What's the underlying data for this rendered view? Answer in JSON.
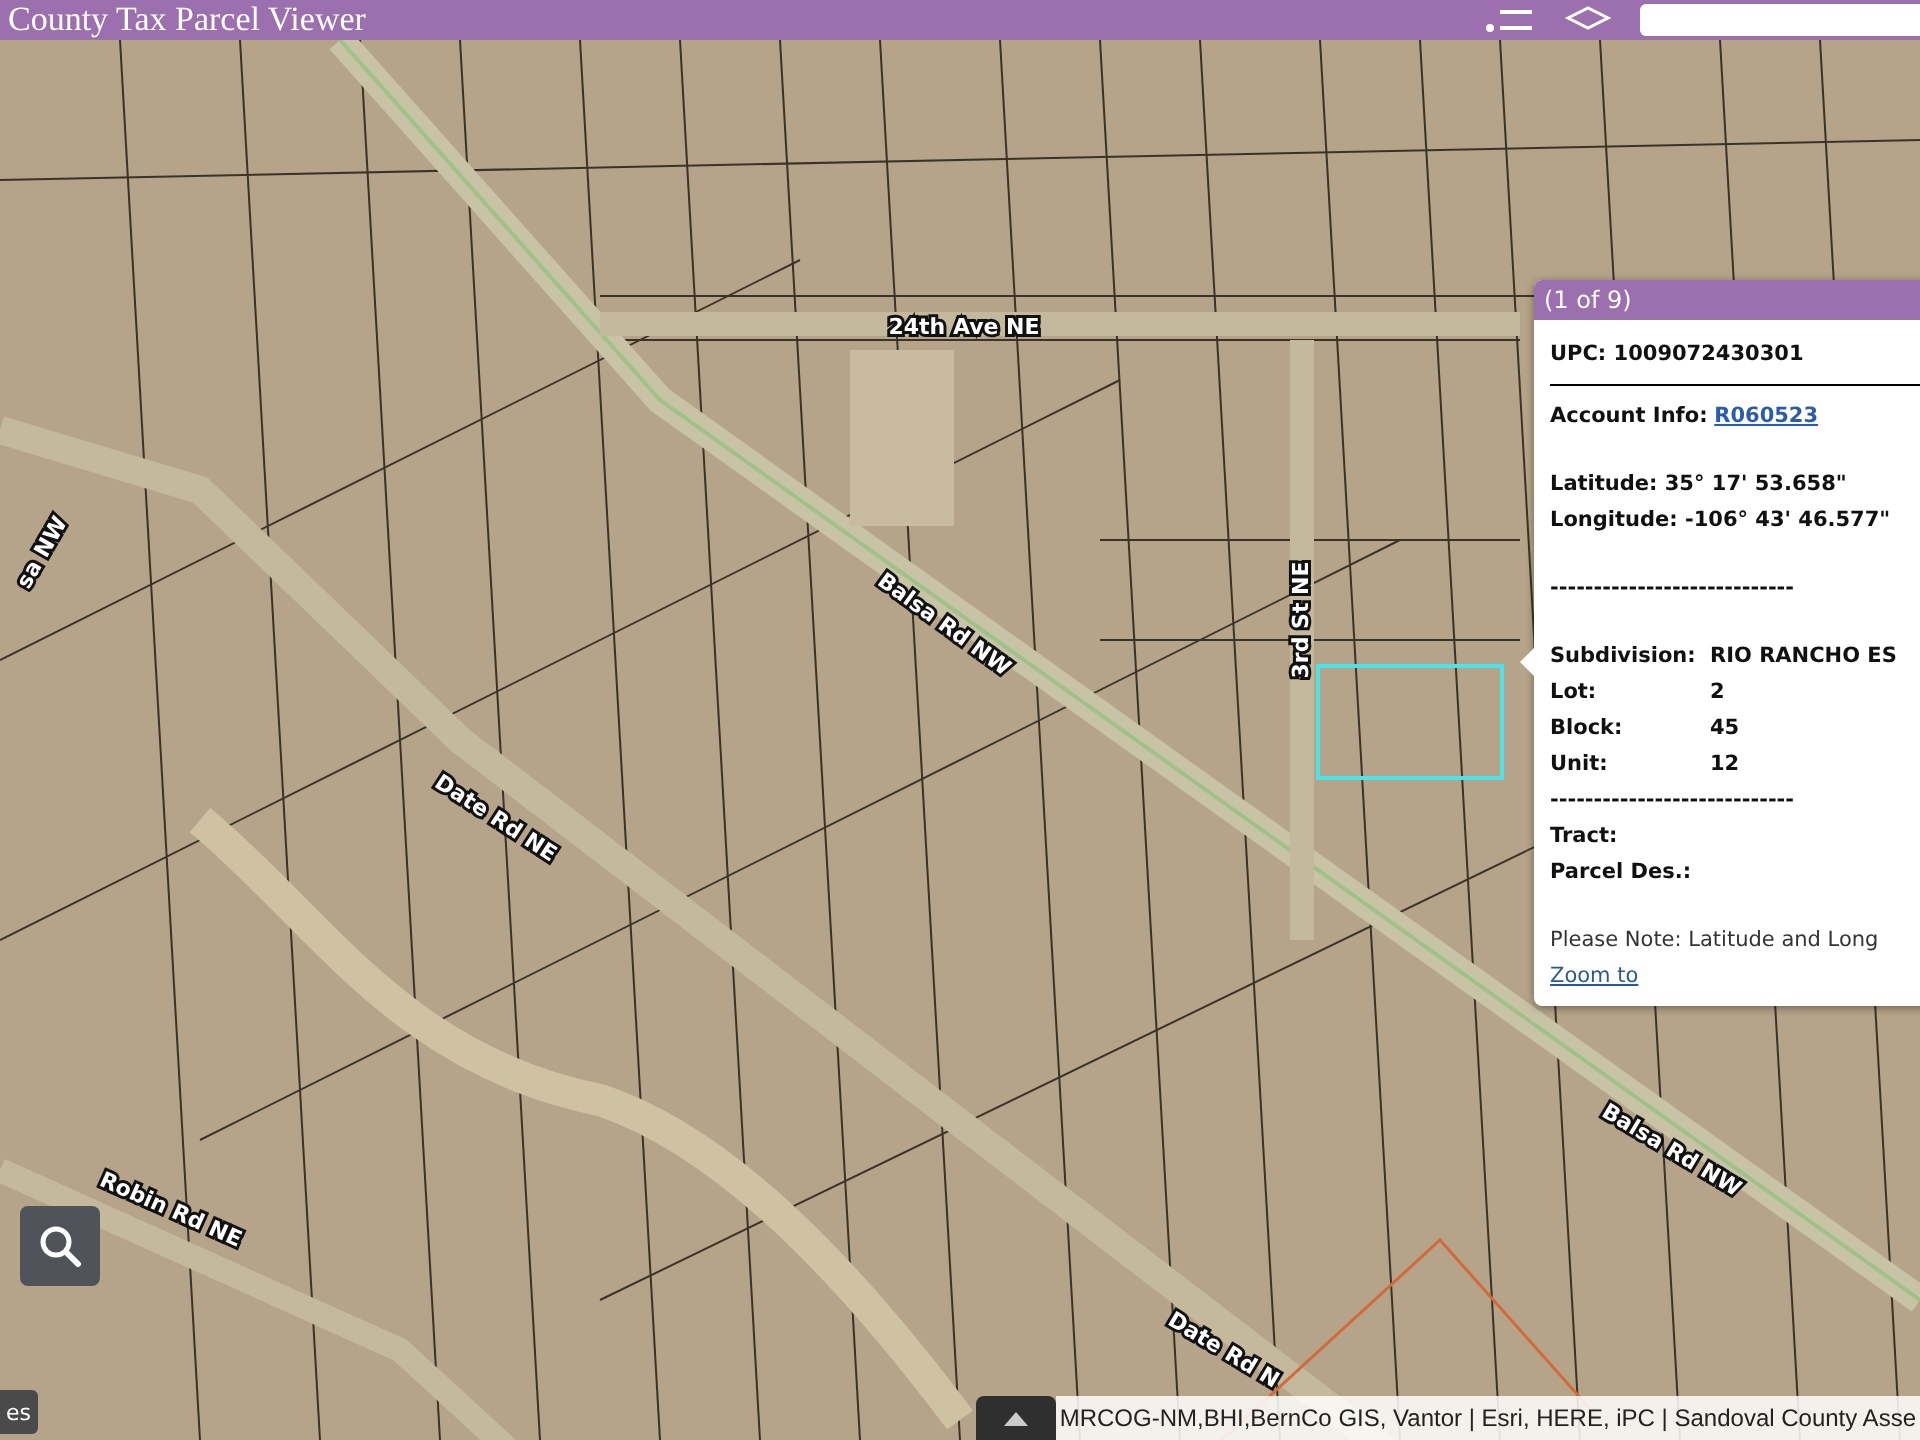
{
  "header": {
    "title": "County Tax Parcel Viewer"
  },
  "map": {
    "road_labels": [
      {
        "text": "24th Ave NE",
        "kind": "road"
      },
      {
        "text": "Balsa Rd NW",
        "kind": "road"
      },
      {
        "text": "3rd St NE",
        "kind": "road"
      },
      {
        "text": "sa NW",
        "kind": "road"
      },
      {
        "text": "Date Rd NE",
        "kind": "road"
      },
      {
        "text": "Balsa Rd NW",
        "kind": "road"
      },
      {
        "text": "Robin Rd NE",
        "kind": "road"
      },
      {
        "text": "Date Rd N",
        "kind": "road"
      }
    ]
  },
  "popup": {
    "counter": "(1 of 9)",
    "upc": "UPC: 1009072430301",
    "account_label": "Account Info:",
    "account_link": "R060523",
    "latitude": "Latitude: 35° 17' 53.658\"",
    "longitude": "Longitude: -106° 43' 46.577\"",
    "divider_1": "----------------------------",
    "fields": [
      {
        "label": "Subdivision:",
        "value": "RIO RANCHO ES"
      },
      {
        "label": "Lot:",
        "value": "2"
      },
      {
        "label": "Block:",
        "value": "45"
      },
      {
        "label": "Unit:",
        "value": "12"
      }
    ],
    "divider_2": "----------------------------",
    "tract": "Tract:",
    "parcel_des": "Parcel Des.:",
    "note": "Please Note: Latitude and Long",
    "zoom_link": "Zoom to"
  },
  "layers_button": "es",
  "attribution": "MRCOG-NM,BHI,BernCo GIS, Vantor | Esri, HERE, iPC | Sandoval County Asse"
}
